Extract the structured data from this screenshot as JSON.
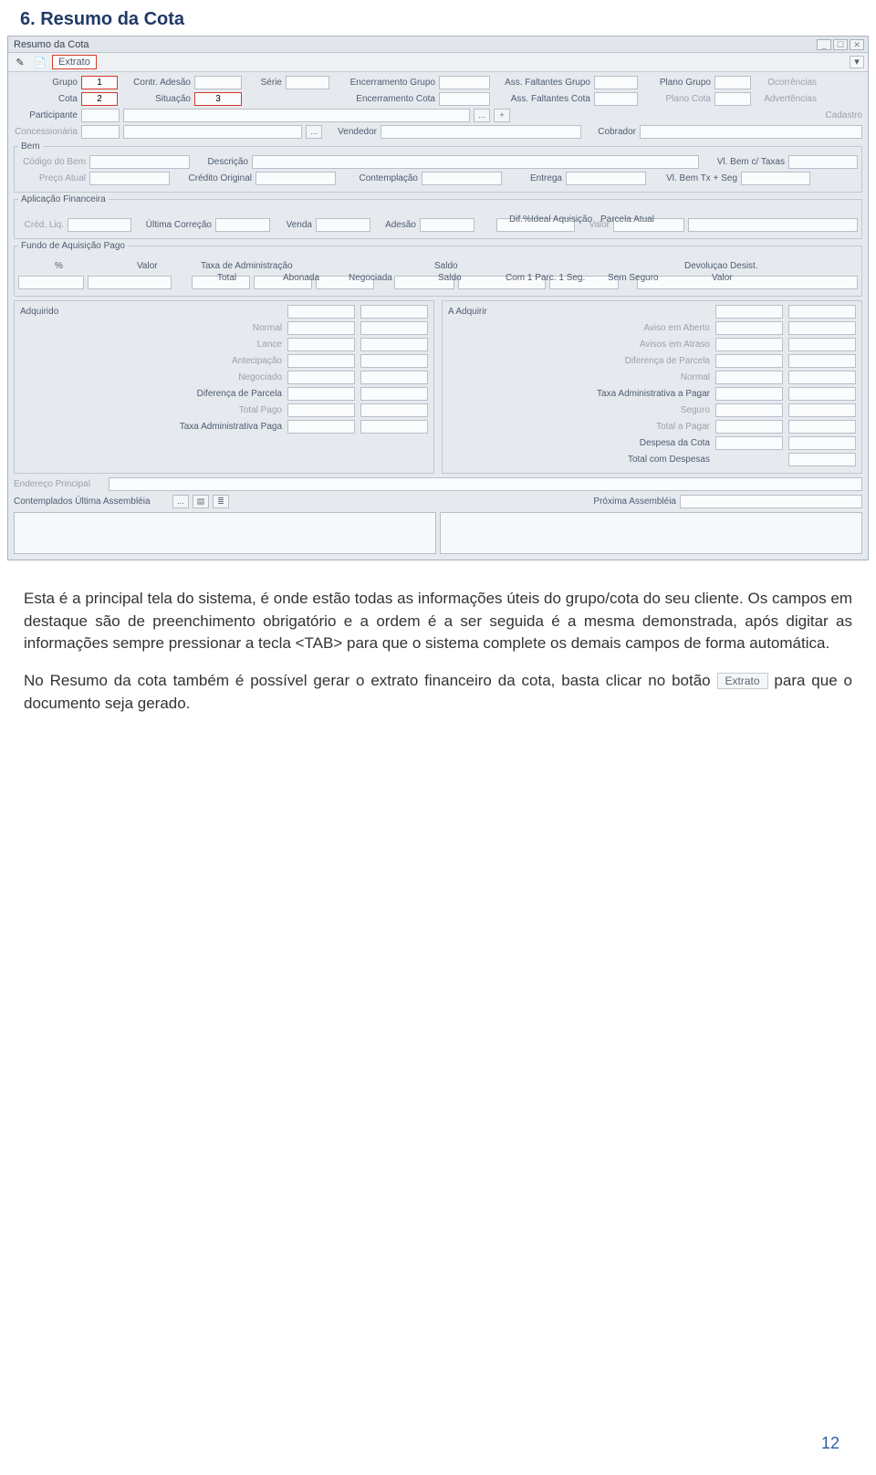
{
  "section_title": "6.  Resumo da Cota",
  "window": {
    "title": "Resumo da Cota",
    "win_min": "_",
    "win_max": "☐",
    "win_close": "✕"
  },
  "toolbar": {
    "icon1": "✎",
    "icon2": "📄",
    "extrato_label": "Extrato",
    "chev": "▾"
  },
  "row1": {
    "grupo_lbl": "Grupo",
    "grupo_val": "1",
    "contr_lbl": "Contr. Adesão",
    "serie_lbl": "Série",
    "enc_grupo_lbl": "Encerramento Grupo",
    "ass_falt_grupo_lbl": "Ass. Faltantes Grupo",
    "plano_grupo_lbl": "Plano Grupo",
    "ocorr_lbl": "Ocorrências"
  },
  "row2": {
    "cota_lbl": "Cota",
    "cota_val": "2",
    "situacao_lbl": "Situação",
    "situacao_val": "3",
    "enc_cota_lbl": "Encerramento Cota",
    "ass_falt_cota_lbl": "Ass. Faltantes Cota",
    "plano_cota_lbl": "Plano Cota",
    "advert_lbl": "Advertências"
  },
  "row3": {
    "participante_lbl": "Participante",
    "btn_dots": "...",
    "btn_plus": "+",
    "cadastro_lbl": "Cadastro"
  },
  "row4": {
    "concess_lbl": "Concessionária",
    "btn_dots": "...",
    "vendedor_lbl": "Vendedor",
    "cobrador_lbl": "Cobrador"
  },
  "grp_bem": {
    "legend": "Bem",
    "codigo_lbl": "Código do Bem",
    "descricao_lbl": "Descrição",
    "vlbem_lbl": "Vl. Bem c/ Taxas",
    "preco_lbl": "Preço Atual",
    "credito_lbl": "Crédito Original",
    "contempl_lbl": "Contemplação",
    "entrega_lbl": "Entrega",
    "vlbem_seg_lbl": "Vl. Bem Tx + Seg"
  },
  "grp_ap": {
    "legend": "Aplicação Financeira",
    "cred_liq_lbl": "Créd. Liq.",
    "ult_corr_lbl": "Última Correção",
    "venda_lbl": "Venda",
    "adesao_lbl": "Adesão",
    "dif_ideal_lbl": "Dif.%Ideal Aquisição",
    "parcela_lbl": "Parcela Atual",
    "valor_lbl": "Valor"
  },
  "grp_fundo": {
    "legend": "Fundo de Aquisição Pago",
    "pct_lbl": "%",
    "valor_lbl": "Valor",
    "taxa_admin_legend": "Taxa de Administração",
    "total_lbl": "Total",
    "abonada_lbl": "Abonada",
    "negociada_lbl": "Negociada",
    "saldo_legend": "Saldo",
    "saldo_lbl": "Saldo",
    "com1_lbl": "Com 1 Parc. 1 Seg.",
    "semseg_lbl": "Sem Seguro",
    "devolucao_legend": "Devoluçao Desist.",
    "dev_valor_lbl": "Valor"
  },
  "panel_left": {
    "adquirido_lbl": "Adquirido",
    "normal_lbl": "Normal",
    "lance_lbl": "Lance",
    "antecip_lbl": "Antecipação",
    "negociado_lbl": "Negociado",
    "dif_parcela_lbl": "Diferença de Parcela",
    "total_pago_lbl": "Total Pago",
    "taxa_adm_paga_lbl": "Taxa Administrativa Paga"
  },
  "panel_right": {
    "a_adquirir_lbl": "A Adquirir",
    "aviso_aberto_lbl": "Aviso em Aberto",
    "avisos_atraso_lbl": "Avisos em Atraso",
    "dif_parcela_lbl": "Diferença de Parcela",
    "normal_lbl": "Normal",
    "taxa_adm_pagar_lbl": "Taxa Administrativa a Pagar",
    "seguro_lbl": "Seguro",
    "total_pagar_lbl": "Total a Pagar",
    "despesa_cota_lbl": "Despesa da Cota",
    "total_despesas_lbl": "Total com Despesas"
  },
  "footer": {
    "endereco_lbl": "Endereço Principal",
    "contempl_ult_lbl": "Contemplados Última Assembléia",
    "btn_dots": "...",
    "btn_a": "▤",
    "btn_b": "≣",
    "prox_assemb_lbl": "Próxima Assembléia"
  },
  "body": {
    "p1": "Esta é a principal tela do sistema, é onde estão todas as informações úteis do grupo/cota do seu cliente. Os campos em destaque são de preenchimento obrigatório e a ordem é a ser seguida é a mesma demonstrada, após digitar as informações sempre pressionar a tecla <TAB> para que o sistema complete os demais campos de forma automática.",
    "p2a": "No Resumo da cota também é possível gerar o extrato financeiro da cota, basta clicar no botão ",
    "p2_btn": "Extrato",
    "p2b": " para que o documento seja gerado."
  },
  "page_number": "12"
}
